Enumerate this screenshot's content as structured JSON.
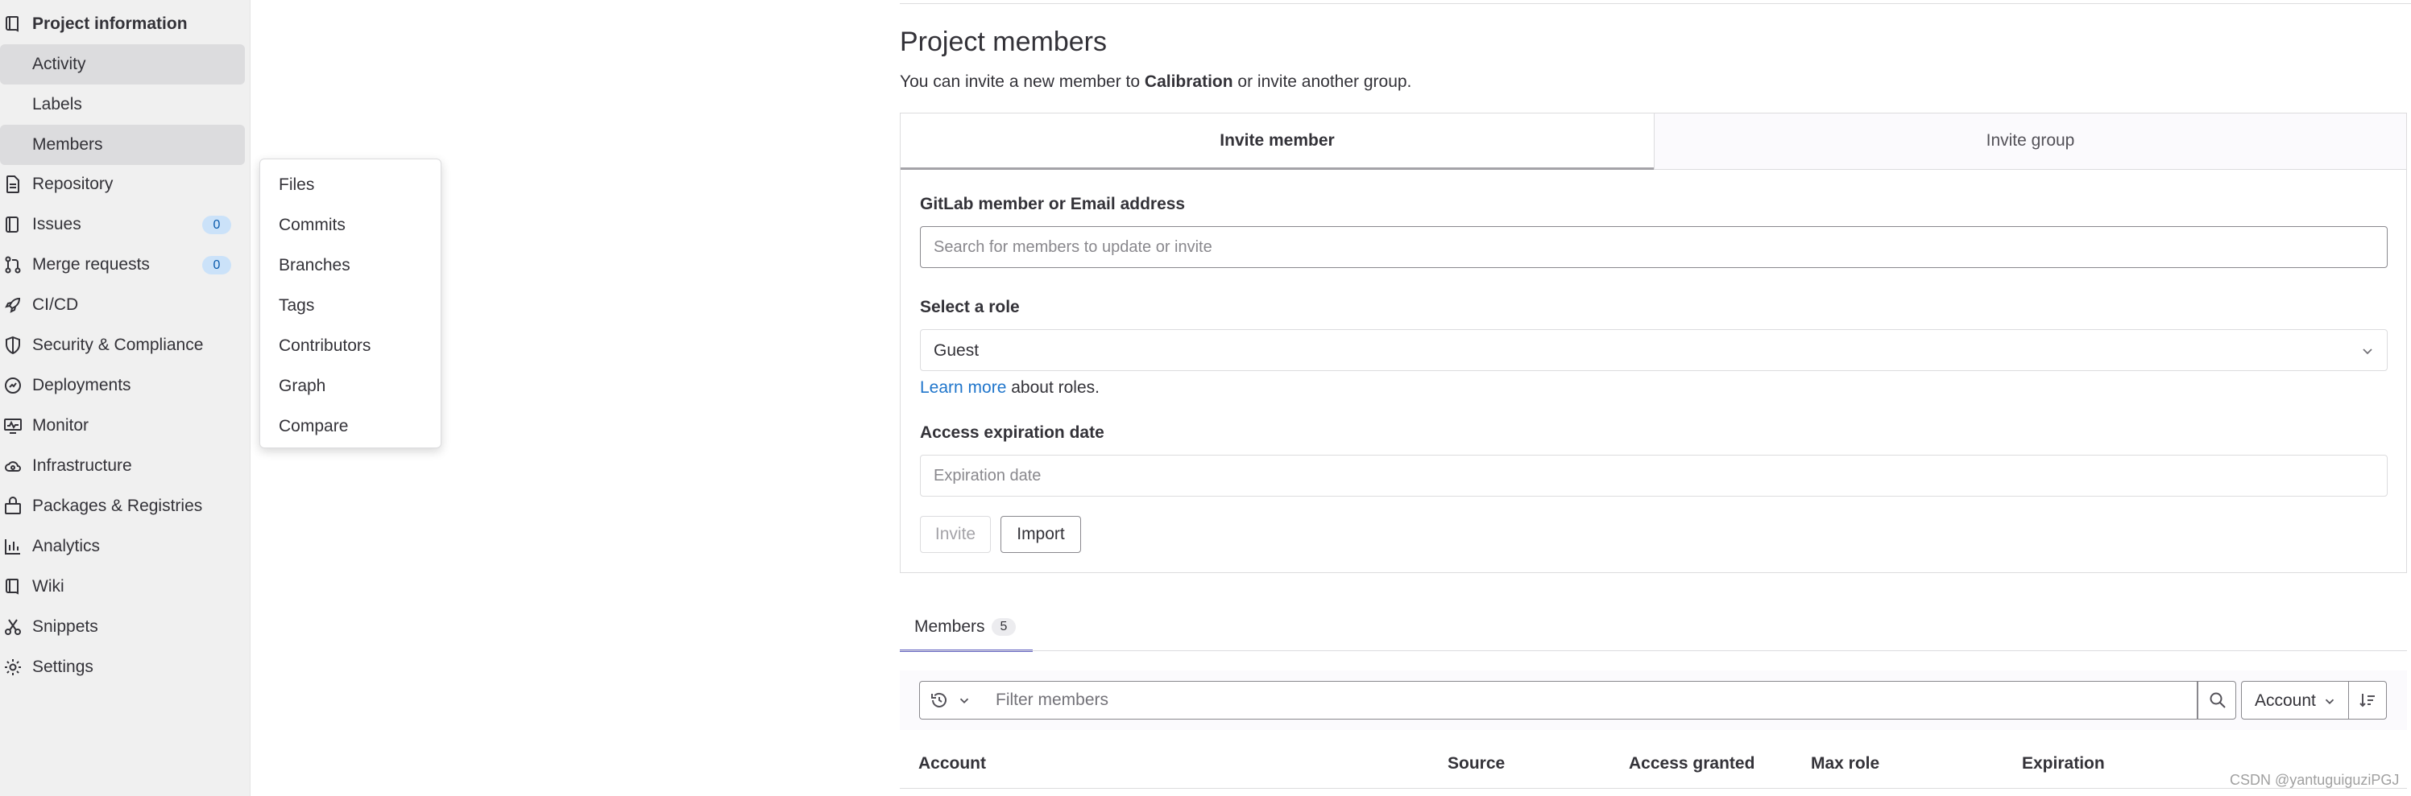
{
  "sidebar": {
    "header": {
      "label": "Project information",
      "icon": "book-icon"
    },
    "subitems": [
      {
        "label": "Activity",
        "active": true
      },
      {
        "label": "Labels",
        "active": false
      },
      {
        "label": "Members",
        "active": true
      }
    ],
    "items": [
      {
        "label": "Repository",
        "icon": "document-icon"
      },
      {
        "label": "Issues",
        "icon": "issues-icon",
        "badge": "0"
      },
      {
        "label": "Merge requests",
        "icon": "merge-request-icon",
        "badge": "0"
      },
      {
        "label": "CI/CD",
        "icon": "rocket-icon"
      },
      {
        "label": "Security & Compliance",
        "icon": "shield-icon"
      },
      {
        "label": "Deployments",
        "icon": "deployments-icon"
      },
      {
        "label": "Monitor",
        "icon": "monitor-icon"
      },
      {
        "label": "Infrastructure",
        "icon": "cloud-gear-icon"
      },
      {
        "label": "Packages & Registries",
        "icon": "package-icon"
      },
      {
        "label": "Analytics",
        "icon": "chart-icon"
      },
      {
        "label": "Wiki",
        "icon": "book-icon"
      },
      {
        "label": "Snippets",
        "icon": "scissors-icon"
      },
      {
        "label": "Settings",
        "icon": "gear-icon"
      }
    ]
  },
  "flyout": {
    "items": [
      "Files",
      "Commits",
      "Branches",
      "Tags",
      "Contributors",
      "Graph",
      "Compare"
    ]
  },
  "page": {
    "title": "Project members",
    "subtitle_before": "You can invite a new member to ",
    "subtitle_project": "Calibration",
    "subtitle_after": " or invite another group."
  },
  "invite": {
    "tabs": {
      "member": "Invite member",
      "group": "Invite group"
    },
    "member_label": "GitLab member or Email address",
    "member_placeholder": "Search for members to update or invite",
    "role_label": "Select a role",
    "role_value": "Guest",
    "learn_more": "Learn more",
    "learn_suffix": " about roles.",
    "expiration_label": "Access expiration date",
    "expiration_placeholder": "Expiration date",
    "invite_button": "Invite",
    "import_button": "Import"
  },
  "members": {
    "tab_label": "Members",
    "count": "5",
    "filter_placeholder": "Filter members",
    "sort_label": "Account",
    "columns": [
      "Account",
      "Source",
      "Access granted",
      "Max role",
      "Expiration"
    ]
  },
  "watermark": "CSDN @yantuguiguziPGJ",
  "colors": {
    "accent": "#1f75cb",
    "tab_underline": "#6666c4",
    "badge_bg": "#cbe2f9",
    "sidebar_bg": "#f0f0f0"
  }
}
